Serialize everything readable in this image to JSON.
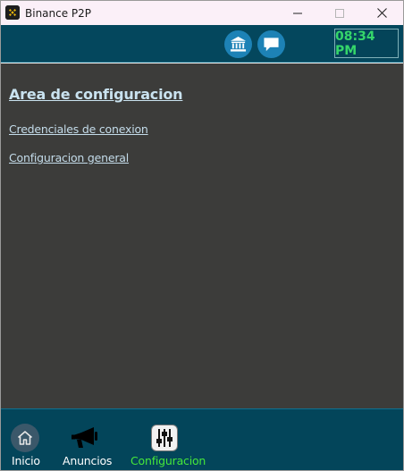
{
  "window": {
    "title": "Binance P2P"
  },
  "header": {
    "clock": "08:34 PM",
    "bank_button_icon": "bank-icon",
    "chat_button_icon": "chat-icon"
  },
  "main": {
    "title": "Area de configuracion",
    "links": [
      {
        "label": "Credenciales de conexion"
      },
      {
        "label": "Configuracion general"
      }
    ]
  },
  "bottom_nav": {
    "items": [
      {
        "label": "Inicio",
        "icon": "home-icon"
      },
      {
        "label": "Anuncios",
        "icon": "megaphone-icon"
      },
      {
        "label": "Configuracion",
        "icon": "sliders-icon",
        "active": true
      }
    ]
  },
  "colors": {
    "header_bg": "#04475d",
    "content_bg": "#3c3c3a",
    "clock_text": "#35d66a",
    "active_nav": "#46e83a",
    "link": "#c4dcea"
  }
}
